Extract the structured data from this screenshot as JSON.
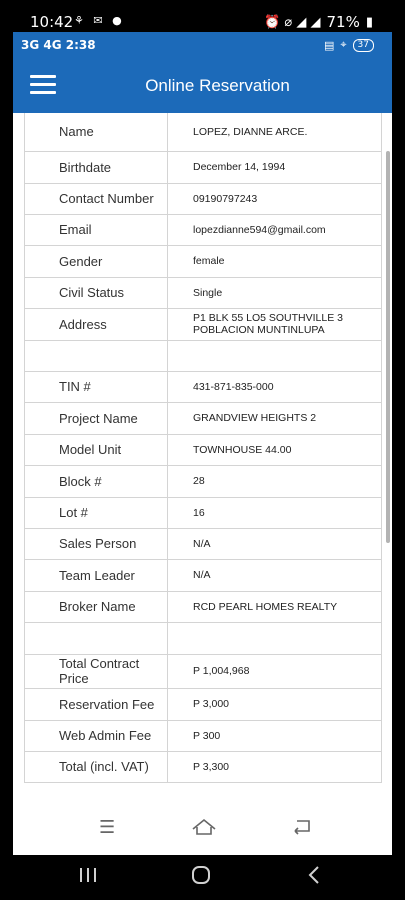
{
  "outer_status": {
    "time": "10:42",
    "left_icons": "⚘ ✉ ●",
    "right_icons": "⏰ ⌀ ◢ ◢",
    "battery": "71%"
  },
  "inner_status": {
    "left": "3G 4G 2:38",
    "battery": "37"
  },
  "header": {
    "title": "Online Reservation"
  },
  "rows": [
    {
      "label": "Name",
      "value": "LOPEZ, DIANNE ARCE."
    },
    {
      "label": "Birthdate",
      "value": "December 14, 1994"
    },
    {
      "label": "Contact Number",
      "value": "09190797243"
    },
    {
      "label": "Email",
      "value": "lopezdianne594@gmail.com"
    },
    {
      "label": "Gender",
      "value": "female"
    },
    {
      "label": "Civil Status",
      "value": "Single"
    },
    {
      "label": "Address",
      "value": "P1 BLK 55 LO5 SOUTHVILLE 3 POBLACION MUNTINLUPA"
    },
    {
      "label": "",
      "value": ""
    },
    {
      "label": "TIN #",
      "value": "431-871-835-000"
    },
    {
      "label": "Project Name",
      "value": "GRANDVIEW HEIGHTS 2"
    },
    {
      "label": "Model Unit",
      "value": "TOWNHOUSE 44.00"
    },
    {
      "label": "Block #",
      "value": "28"
    },
    {
      "label": "Lot #",
      "value": "16"
    },
    {
      "label": "Sales Person",
      "value": "N/A"
    },
    {
      "label": "Team Leader",
      "value": "N/A"
    },
    {
      "label": "Broker Name",
      "value": "RCD PEARL HOMES REALTY"
    },
    {
      "label": "",
      "value": ""
    },
    {
      "label": "Total Contract Price",
      "value": "P 1,004,968"
    },
    {
      "label": "Reservation Fee",
      "value": "P 3,000"
    },
    {
      "label": "Web Admin Fee",
      "value": "P 300"
    },
    {
      "label": "Total (incl. VAT)",
      "value": "P 3,300"
    }
  ],
  "nav_icons": [
    "menu-icon",
    "home-icon",
    "back-icon"
  ],
  "system_nav_icons": [
    "recents-icon",
    "home-icon",
    "back-icon"
  ],
  "colors": {
    "header": "#1c6ab9"
  }
}
